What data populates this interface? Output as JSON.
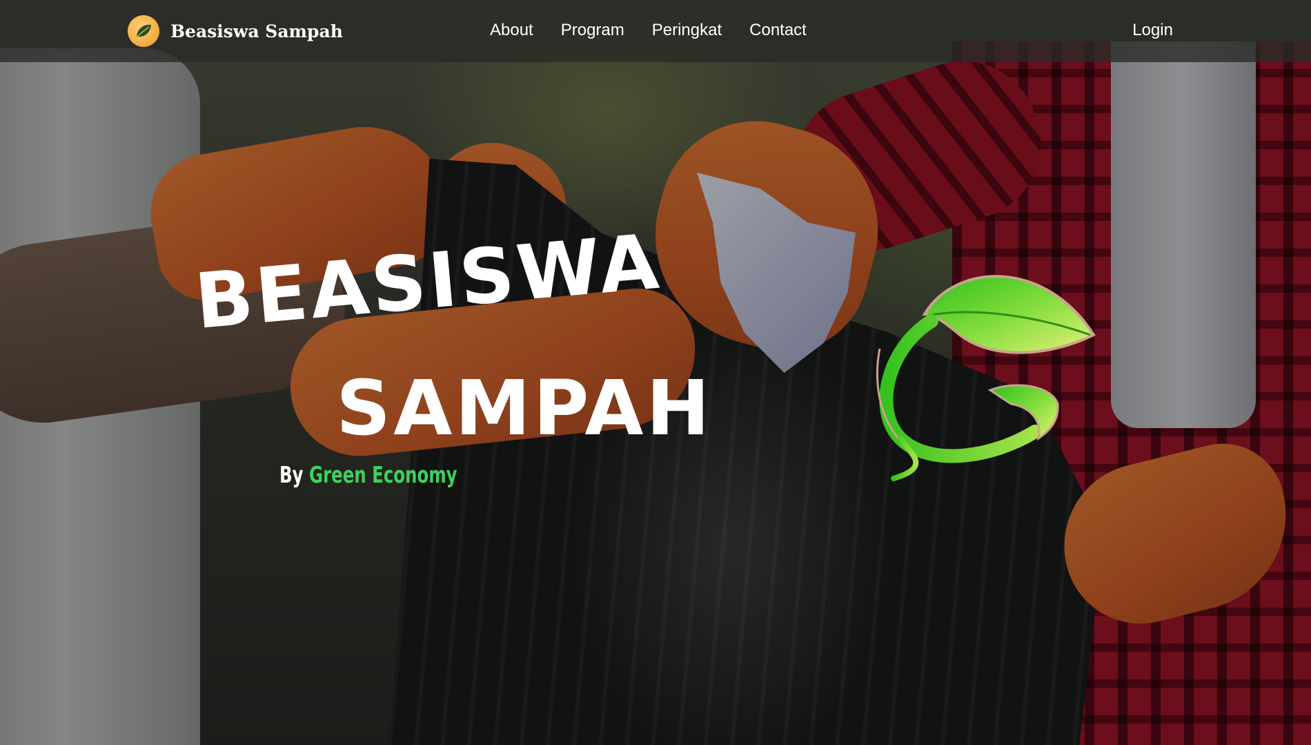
{
  "navbar": {
    "brand_name": "Beasiswa Sampah",
    "links": [
      "About",
      "Program",
      "Peringkat",
      "Contact"
    ],
    "login_label": "Login"
  },
  "hero": {
    "title_line1": "BEASISWA",
    "title_line2": "SAMPAH",
    "by_prefix": "By",
    "by_org": "Green Economy"
  },
  "colors": {
    "navbar_bg": "#2a2c28",
    "text": "#ffffff",
    "accent_green": "#3ed15c",
    "logo_orange": "#f2a93c"
  },
  "icons": {
    "brand_logo": "leaf-in-circle-icon",
    "hero_logo": "green-recycle-leaf-logo"
  }
}
